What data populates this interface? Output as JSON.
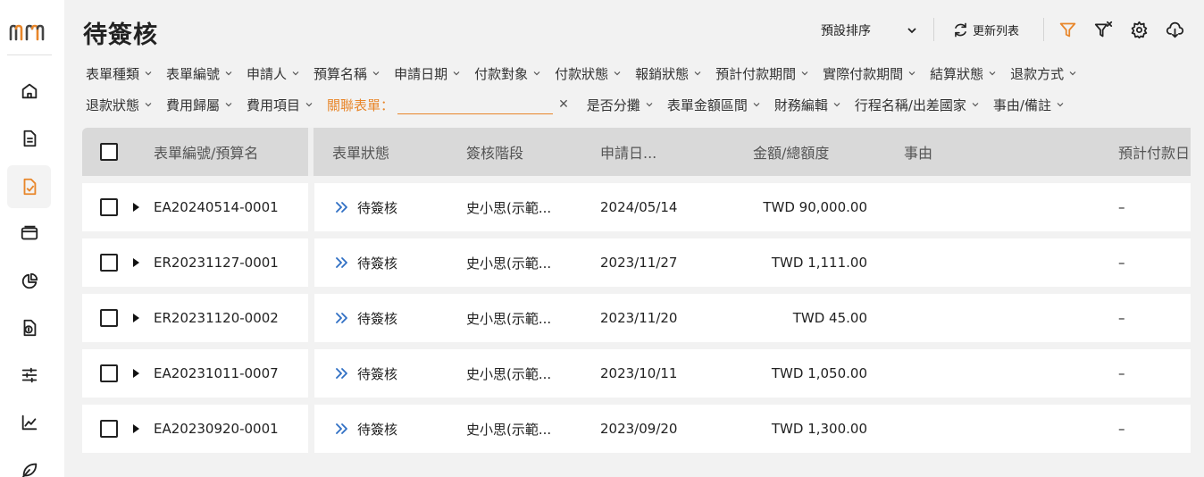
{
  "page_title": "待簽核",
  "toolbar": {
    "sort_label": "預設排序",
    "refresh_label": "更新列表"
  },
  "sidebar": {
    "items": [
      {
        "icon": "home-icon"
      },
      {
        "icon": "document-icon"
      },
      {
        "icon": "approval-icon",
        "active": true
      },
      {
        "icon": "card-icon"
      },
      {
        "icon": "pie-chart-icon"
      },
      {
        "icon": "dollar-doc-icon"
      },
      {
        "icon": "sliders-icon"
      },
      {
        "icon": "line-chart-icon"
      },
      {
        "icon": "leaf-icon"
      }
    ]
  },
  "filters": {
    "row1": [
      "表單種類",
      "表單編號",
      "申請人",
      "預算名稱",
      "申請日期",
      "付款對象",
      "付款狀態",
      "報銷狀態",
      "預計付款期間",
      "實際付款期間",
      "結算狀態",
      "退款方式"
    ],
    "row2a": [
      "退款狀態",
      "費用歸屬",
      "費用項目"
    ],
    "active_label": "關聯表單：",
    "active_value": "",
    "row2b": [
      "是否分攤",
      "表單金額區間",
      "財務編輯",
      "行程名稱/出差國家",
      "事由/備註"
    ]
  },
  "table": {
    "columns": [
      "表單編號/預算名",
      "表單狀態",
      "簽核階段",
      "申請日...",
      "金額/總額度",
      "事由",
      "預計付款日"
    ],
    "rows": [
      {
        "id": "EA20240514-0001",
        "status": "待簽核",
        "stage": "史小思(示範...",
        "date": "2024/05/14",
        "amount": "TWD 90,000.00",
        "reason": "",
        "pay_date": "–"
      },
      {
        "id": "ER20231127-0001",
        "status": "待簽核",
        "stage": "史小思(示範...",
        "date": "2023/11/27",
        "amount": "TWD 1,111.00",
        "reason": "",
        "pay_date": "–"
      },
      {
        "id": "ER20231120-0002",
        "status": "待簽核",
        "stage": "史小思(示範...",
        "date": "2023/11/20",
        "amount": "TWD 45.00",
        "reason": "",
        "pay_date": "–"
      },
      {
        "id": "EA20231011-0007",
        "status": "待簽核",
        "stage": "史小思(示範...",
        "date": "2023/10/11",
        "amount": "TWD 1,050.00",
        "reason": "",
        "pay_date": "–"
      },
      {
        "id": "EA20230920-0001",
        "status": "待簽核",
        "stage": "史小思(示範...",
        "date": "2023/09/20",
        "amount": "TWD 1,300.00",
        "reason": "",
        "pay_date": "–"
      }
    ]
  },
  "colors": {
    "accent": "#e8862a",
    "status_icon": "#2f6fc4",
    "logo_gray": "#444444"
  }
}
